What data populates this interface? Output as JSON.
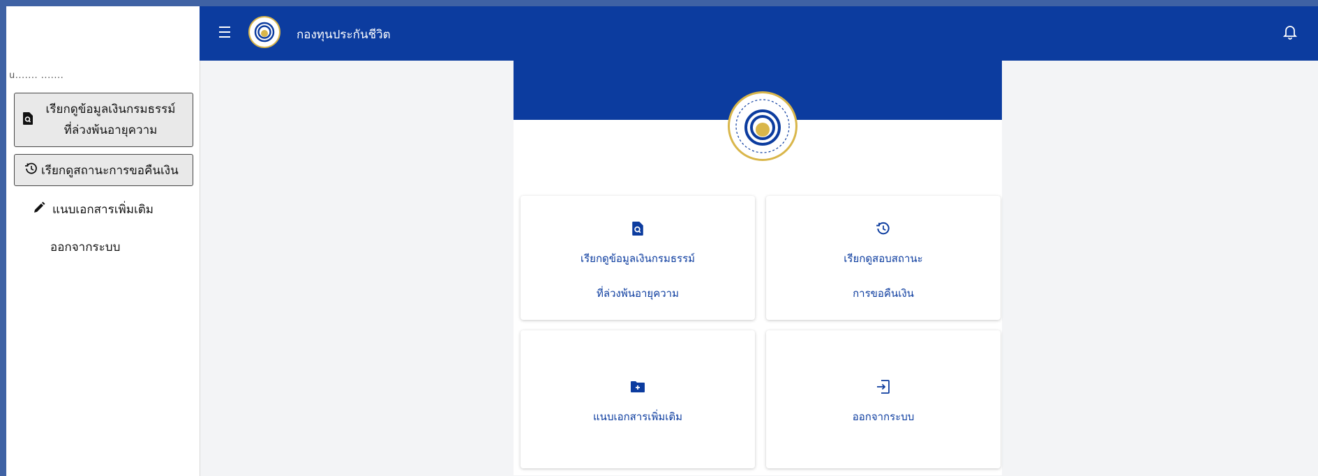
{
  "app": {
    "title": "กองทุนประกันชีวิต"
  },
  "sidebar": {
    "user_text": "u....... .......",
    "items": [
      {
        "label_line1": "เรียกดูข้อมูลเงินกรมธรรม์",
        "label_line2": "ที่ล่วงพ้นอายุความ",
        "icon": "search-document-icon"
      },
      {
        "label": "เรียกดูสถานะการขอคืนเงิน",
        "icon": "history-icon"
      },
      {
        "label": "แนบเอกสารเพิ่มเติม",
        "icon": "pencil-icon"
      },
      {
        "label": "ออกจากระบบ"
      }
    ]
  },
  "cards": [
    {
      "line1": "เรียกดูข้อมูลเงินกรมธรรม์",
      "line2": "ที่ล่วงพ้นอายุความ",
      "icon": "search-document-icon"
    },
    {
      "line1": "เรียกดูสอบสถานะ",
      "line2": "การขอคืนเงิน",
      "icon": "history-icon"
    },
    {
      "line1": "แนบเอกสารเพิ่มเติม",
      "icon": "folder-add-icon"
    },
    {
      "line1": "ออกจากระบบ",
      "icon": "logout-icon"
    }
  ],
  "colors": {
    "primary": "#0c3c9f",
    "background": "#f3f4f6",
    "logo_gold": "#d9b64a"
  }
}
